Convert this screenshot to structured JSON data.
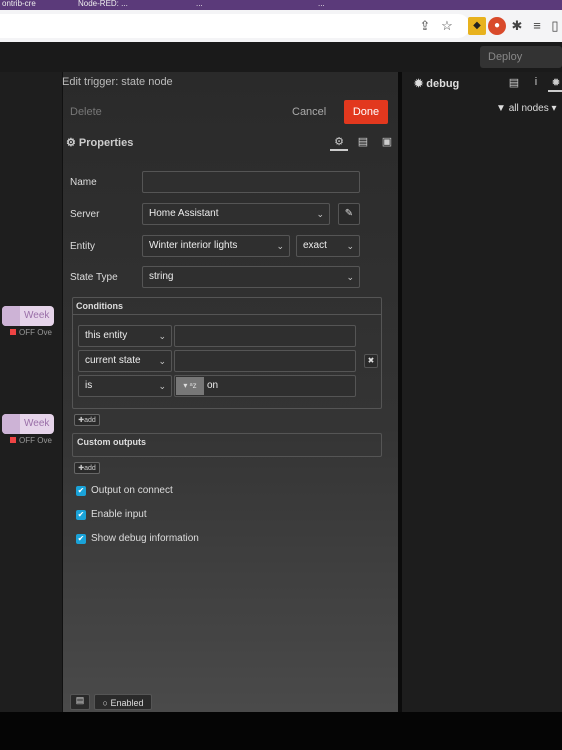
{
  "browser": {
    "tabs": [
      "ontrib-cre",
      "Node-RED: ...",
      "...",
      "..."
    ],
    "toolbar_icons": [
      "share-icon",
      "star-icon",
      "extension-icon",
      "extension-icon",
      "puzzle-icon",
      "reading-list-icon",
      "sidebar-icon"
    ]
  },
  "header": {
    "deploy_label": "Deploy"
  },
  "workspace": {
    "nodes": [
      {
        "label": "Week",
        "status": "OFF Ove"
      },
      {
        "label": "Week",
        "status": "OFF Ove"
      }
    ]
  },
  "editor": {
    "title": "Edit trigger: state node",
    "delete_label": "Delete",
    "cancel_label": "Cancel",
    "done_label": "Done",
    "properties_label": "Properties",
    "name_label": "Name",
    "name_value": "",
    "server_label": "Server",
    "server_value": "Home Assistant",
    "entity_label": "Entity",
    "entity_value": "Winter interior lights",
    "entity_match": "exact",
    "state_type_label": "State Type",
    "state_type_value": "string",
    "conditions_label": "Conditions",
    "conditions": [
      {
        "left": "this entity",
        "right": ""
      },
      {
        "left": "current state",
        "right": ""
      },
      {
        "left": "is",
        "right": "on"
      }
    ],
    "add_label": "add",
    "custom_outputs_label": "Custom outputs",
    "checkboxes": [
      {
        "label": "Output on connect",
        "checked": true
      },
      {
        "label": "Enable input",
        "checked": true
      },
      {
        "label": "Show debug information",
        "checked": true
      }
    ],
    "enabled_label": "Enabled"
  },
  "sidebar": {
    "debug_title": "debug",
    "filter_label": "all nodes"
  },
  "colors": {
    "done": "#e2381e",
    "checkbox": "#1aa3d9"
  }
}
